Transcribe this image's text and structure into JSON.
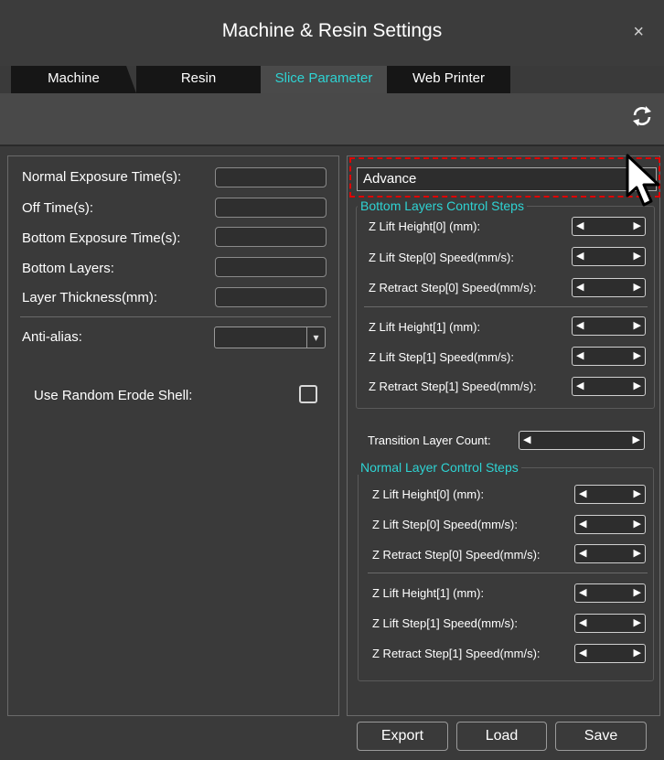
{
  "window": {
    "title": "Machine & Resin Settings",
    "close_glyph": "×"
  },
  "tabs": [
    {
      "label": "Machine",
      "active": false
    },
    {
      "label": "Resin",
      "active": false
    },
    {
      "label": "Slice Parameter",
      "active": true
    },
    {
      "label": "Web Printer",
      "active": false
    }
  ],
  "toolbar": {
    "refresh_icon": "refresh-icon"
  },
  "left_panel": {
    "normal_exposure_label": "Normal Exposure Time(s):",
    "normal_exposure_value": "",
    "off_time_label": "Off Time(s):",
    "off_time_value": "",
    "bottom_exposure_label": "Bottom Exposure Time(s):",
    "bottom_exposure_value": "",
    "bottom_layers_label": "Bottom Layers:",
    "bottom_layers_value": "",
    "layer_thickness_label": "Layer Thickness(mm):",
    "layer_thickness_value": "",
    "anti_alias_label": "Anti-alias:",
    "anti_alias_value": "",
    "random_erode_label": "Use Random Erode Shell:",
    "random_erode_checked": false
  },
  "right_panel": {
    "mode_value": "Advance",
    "bottom_group": {
      "title": "Bottom Layers Control Steps",
      "rows": [
        {
          "label": "Z Lift Height[0] (mm):",
          "value": ""
        },
        {
          "label": "Z Lift Step[0] Speed(mm/s):",
          "value": ""
        },
        {
          "label": "Z Retract Step[0] Speed(mm/s):",
          "value": ""
        },
        {
          "label": "Z Lift Height[1] (mm):",
          "value": ""
        },
        {
          "label": "Z Lift Step[1] Speed(mm/s):",
          "value": ""
        },
        {
          "label": "Z Retract Step[1] Speed(mm/s):",
          "value": ""
        }
      ]
    },
    "transition_label": "Transition Layer Count:",
    "transition_value": "",
    "normal_group": {
      "title": "Normal Layer Control Steps",
      "rows": [
        {
          "label": "Z Lift Height[0] (mm):",
          "value": ""
        },
        {
          "label": "Z Lift Step[0] Speed(mm/s):",
          "value": ""
        },
        {
          "label": "Z Retract Step[0] Speed(mm/s):",
          "value": ""
        },
        {
          "label": "Z Lift Height[1] (mm):",
          "value": ""
        },
        {
          "label": "Z Lift Step[1] Speed(mm/s):",
          "value": ""
        },
        {
          "label": "Z Retract Step[1] Speed(mm/s):",
          "value": ""
        }
      ]
    }
  },
  "footer": {
    "export_label": "Export",
    "load_label": "Load",
    "save_label": "Save"
  },
  "colors": {
    "accent": "#2ed3d3",
    "highlight": "#e00000",
    "background": "#3a3a3a",
    "tab_dark": "#161616"
  }
}
